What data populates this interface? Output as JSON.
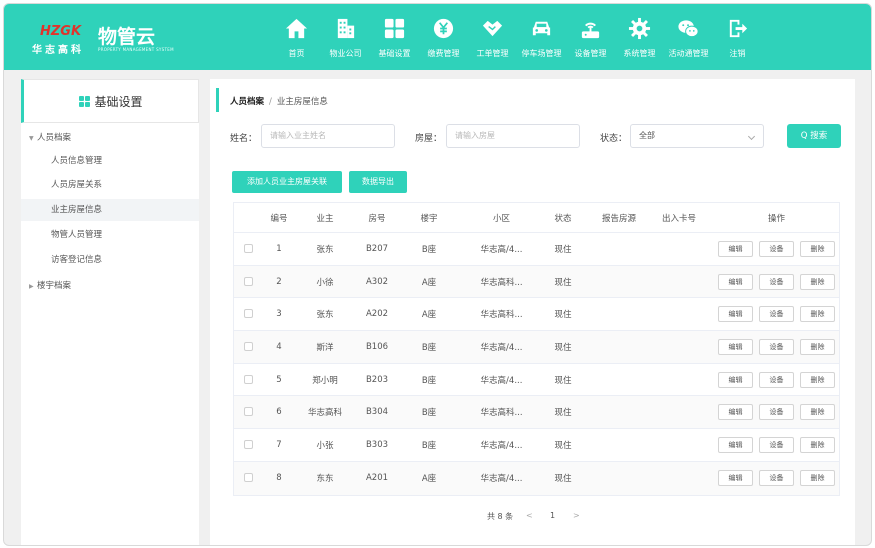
{
  "brand": {
    "logo_mark": "HZGK",
    "logo_sub": "华志高科",
    "name": "物管云",
    "tagline": "PROPERTY MANAGEMENT SYSTEM",
    "accent_color": "#2fd2ba"
  },
  "nav": [
    {
      "label": "首页",
      "icon": "home-icon"
    },
    {
      "label": "物业公司",
      "icon": "building-icon"
    },
    {
      "label": "基础设置",
      "icon": "grid-icon"
    },
    {
      "label": "缴费管理",
      "icon": "yen-icon"
    },
    {
      "label": "工单管理",
      "icon": "handshake-icon"
    },
    {
      "label": "停车场管理",
      "icon": "car-icon"
    },
    {
      "label": "设备管理",
      "icon": "router-icon"
    },
    {
      "label": "系统管理",
      "icon": "gear-icon"
    },
    {
      "label": "活动通管理",
      "icon": "chat-icon"
    },
    {
      "label": "注销",
      "icon": "logout-icon"
    }
  ],
  "sidebar": {
    "title": "基础设置",
    "groups": [
      {
        "label": "人员档案",
        "items": [
          "人员信息管理",
          "人员房屋关系",
          "业主房屋信息",
          "物管人员管理",
          "访客登记信息"
        ]
      },
      {
        "label": "楼宇档案",
        "items": []
      }
    ],
    "active_item": "业主房屋信息"
  },
  "breadcrumb": {
    "root": "人员档案",
    "separator": "/",
    "current": "业主房屋信息"
  },
  "filters": {
    "name_label": "姓名：",
    "name_placeholder": "请输入业主姓名",
    "room_label": "房屋：",
    "room_placeholder": "请输入房屋",
    "status_label": "状态：",
    "status_value": "全部",
    "search_button": "Q 搜索"
  },
  "actions": {
    "add_button": "添加人员业主房屋关联",
    "export_button": "数据导出"
  },
  "table": {
    "columns": [
      "编号",
      "业主",
      "房号",
      "楼宇",
      "小区",
      "状态",
      "报告房源",
      "出入卡号",
      "操作"
    ],
    "rows": [
      {
        "id": "1",
        "owner": "张东",
        "room": "B207",
        "building": "B座",
        "community": "华志高/4...",
        "status": "现住"
      },
      {
        "id": "2",
        "owner": "小徐",
        "room": "A302",
        "building": "A座",
        "community": "华志高科...",
        "status": "现住"
      },
      {
        "id": "3",
        "owner": "张东",
        "room": "A202",
        "building": "A座",
        "community": "华志高科...",
        "status": "现住"
      },
      {
        "id": "4",
        "owner": "斯洋",
        "room": "B106",
        "building": "B座",
        "community": "华志高/4...",
        "status": "现住"
      },
      {
        "id": "5",
        "owner": "郑小明",
        "room": "B203",
        "building": "B座",
        "community": "华志高/4...",
        "status": "现住"
      },
      {
        "id": "6",
        "owner": "华志高科",
        "room": "B304",
        "building": "B座",
        "community": "华志高科...",
        "status": "现住"
      },
      {
        "id": "7",
        "owner": "小张",
        "room": "B303",
        "building": "B座",
        "community": "华志高/4...",
        "status": "现住"
      },
      {
        "id": "8",
        "owner": "东东",
        "room": "A201",
        "building": "A座",
        "community": "华志高/4...",
        "status": "现住"
      }
    ],
    "row_actions": [
      "编辑",
      "设备",
      "删除"
    ]
  },
  "pagination": {
    "total_text": "共 8 条",
    "prev": "<",
    "page": "1",
    "next": ">"
  }
}
